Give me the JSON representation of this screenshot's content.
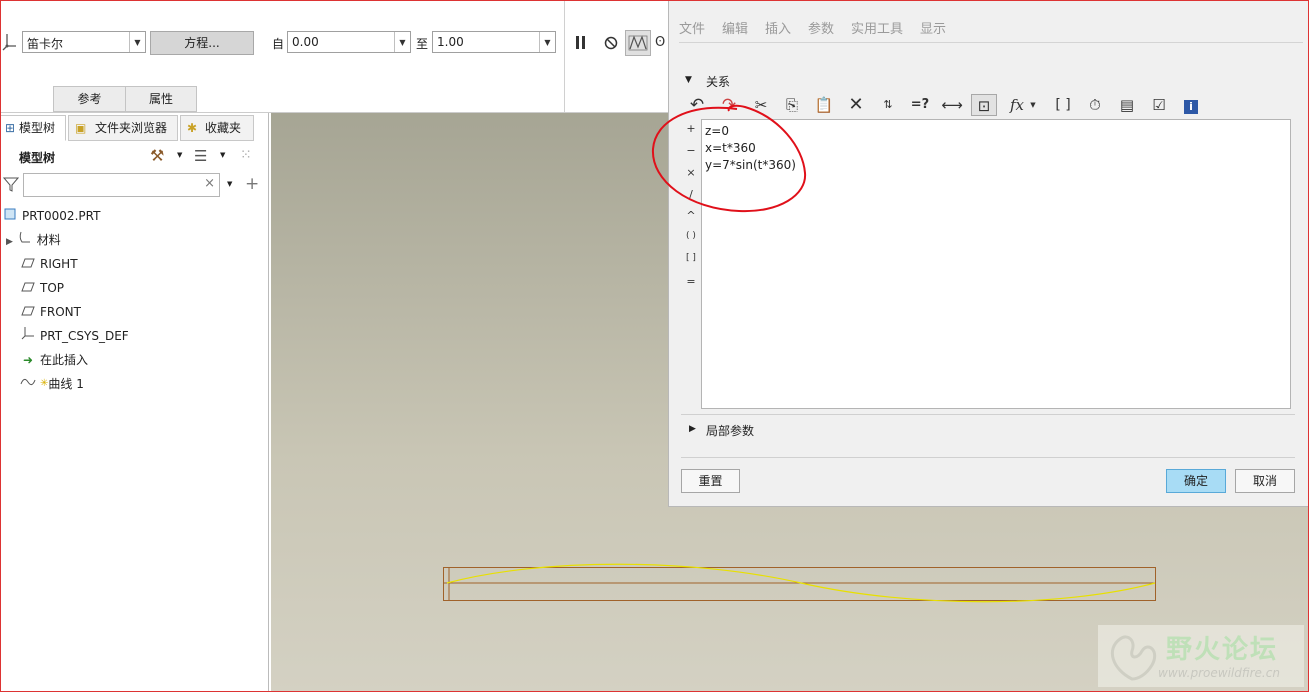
{
  "ribbon": {
    "coord_system": "笛卡尔",
    "equation_button": "方程...",
    "from_label": "自",
    "from_value": "0.00",
    "to_label": "至",
    "to_value": "1.00",
    "tab_reference": "参考",
    "tab_properties": "属性"
  },
  "nav": {
    "tabs": [
      "模型树",
      "文件夹浏览器",
      "收藏夹"
    ],
    "tree_title": "模型树",
    "filter_placeholder": ""
  },
  "tree": {
    "items": [
      {
        "label": "PRT0002.PRT",
        "icon": "part-icon"
      },
      {
        "label": "材料",
        "icon": "material-icon"
      },
      {
        "label": "RIGHT",
        "icon": "datum-plane-icon"
      },
      {
        "label": "TOP",
        "icon": "datum-plane-icon"
      },
      {
        "label": "FRONT",
        "icon": "datum-plane-icon"
      },
      {
        "label": "PRT_CSYS_DEF",
        "icon": "csys-icon"
      },
      {
        "label": "在此插入",
        "icon": "insert-arrow-icon"
      },
      {
        "label": "曲线 1",
        "icon": "curve-icon"
      }
    ]
  },
  "dialog": {
    "menu": [
      "文件",
      "编辑",
      "插入",
      "参数",
      "实用工具",
      "显示"
    ],
    "section_relations": "关系",
    "operators": [
      "+",
      "−",
      "×",
      "/",
      "^",
      "( )",
      "[ ]",
      "="
    ],
    "equations": [
      "z=0",
      "x=t*360",
      "y=7*sin(t*360)"
    ],
    "section_local_params": "局部参数",
    "reset_button": "重置",
    "ok_button": "确定",
    "cancel_button": "取消"
  },
  "watermark": {
    "title": "野火论坛",
    "url": "www.proewildfire.cn"
  },
  "colors": {
    "curve": "#e8e000",
    "bbox": "#a0622a",
    "annotation_circle": "#e0101a",
    "ok_button_bg": "#a8dcf5"
  }
}
